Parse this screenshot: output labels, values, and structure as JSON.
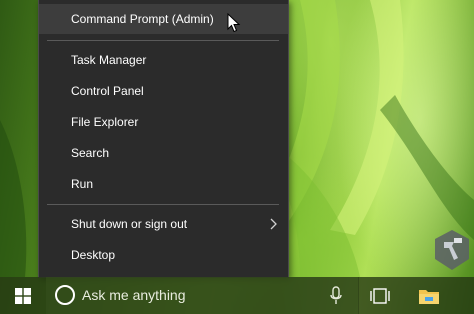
{
  "menu": {
    "items": [
      {
        "label": "Command Prompt (Admin)",
        "highlighted": true
      },
      {
        "label": "Task Manager"
      },
      {
        "label": "Control Panel"
      },
      {
        "label": "File Explorer"
      },
      {
        "label": "Search"
      },
      {
        "label": "Run"
      },
      {
        "label": "Shut down or sign out",
        "has_submenu": true
      },
      {
        "label": "Desktop"
      }
    ]
  },
  "taskbar": {
    "search_placeholder": "Ask me anything",
    "icons": [
      "windows-logo-icon",
      "cortana-icon",
      "microphone-icon",
      "task-view-icon",
      "file-explorer-icon"
    ]
  },
  "colors": {
    "menu_bg": "#2b2b2b",
    "menu_highlight": "#3d3d3d",
    "menu_text": "#ffffff",
    "taskbar_bg": "#22341299",
    "explorer_folder": "#f2c44d",
    "explorer_accent": "#4aa3e8"
  }
}
